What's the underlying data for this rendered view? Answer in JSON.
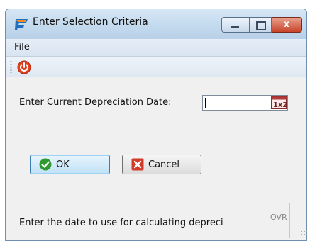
{
  "window": {
    "title": "Enter Selection Criteria",
    "app_icon": "app-flag-icon",
    "caption_buttons": {
      "minimize_icon": "minimize-icon",
      "maximize_icon": "maximize-icon",
      "close_glyph": "x"
    }
  },
  "menu": {
    "file_label": "File"
  },
  "toolbar": {
    "power_icon": "power-icon"
  },
  "form": {
    "label": "Enter Current Depreciation Date:",
    "date_value": "",
    "calendar_icon": "calendar-icon"
  },
  "buttons": {
    "ok_label": "OK",
    "cancel_label": "Cancel"
  },
  "status": {
    "text": "Enter the date to use for calculating depreci",
    "ovr": "OVR"
  },
  "colors": {
    "accent": "#3c7fb1",
    "title_bar": "#c6dcef",
    "close_button": "#c7452a",
    "power_icon": "#e0401f",
    "ok_icon": "#2e9a2e",
    "cancel_icon": "#d23a2a"
  }
}
